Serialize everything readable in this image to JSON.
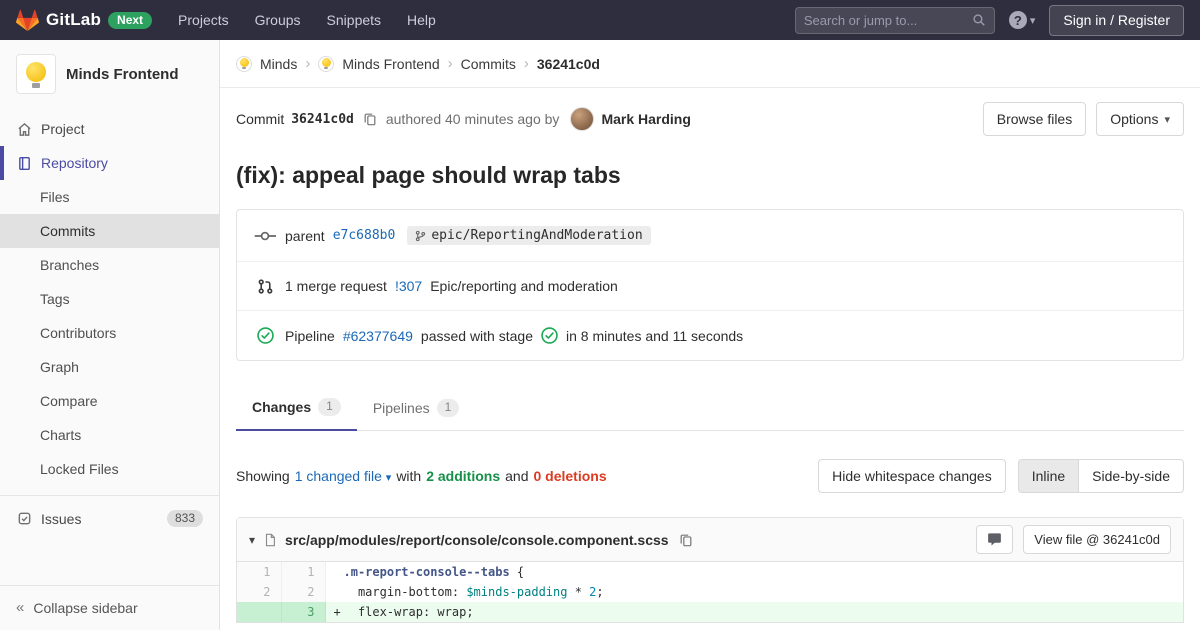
{
  "colors": {
    "navbar_bg": "#2e2e3f",
    "accent": "#4b4ba3",
    "link": "#1b69b6",
    "success": "#1aaa55",
    "additions_green": "#168f48",
    "deletions_red": "#db3b21",
    "next_badge_green": "#2da160",
    "added_line_bg": "#ecfdf0"
  },
  "icons": {
    "caret_down": "▾",
    "separator": "›",
    "collapse": "«",
    "help": "?",
    "project_avatar": "lightbulb"
  },
  "navbar": {
    "brand": "GitLab",
    "next_badge": "Next",
    "menu": {
      "projects": "Projects",
      "groups": "Groups",
      "snippets": "Snippets",
      "help": "Help"
    },
    "search_placeholder": "Search or jump to...",
    "sign_in_label": "Sign in / Register"
  },
  "sidebar": {
    "project_name": "Minds Frontend",
    "items": {
      "project": "Project",
      "repository": "Repository",
      "files": "Files",
      "commits": "Commits",
      "branches": "Branches",
      "tags": "Tags",
      "contributors": "Contributors",
      "graph": "Graph",
      "compare": "Compare",
      "charts": "Charts",
      "locked_files": "Locked Files",
      "issues": "Issues"
    },
    "issues_count": "833",
    "collapse_label": "Collapse sidebar"
  },
  "breadcrumb": {
    "group": "Minds",
    "project": "Minds Frontend",
    "section": "Commits",
    "current": "36241c0d"
  },
  "commit": {
    "label": "Commit",
    "sha": "36241c0d",
    "authored_text": "authored 40 minutes ago by",
    "author": "Mark Harding",
    "browse_files_label": "Browse files",
    "options_label": "Options",
    "title": "(fix): appeal page should wrap tabs",
    "parent_label": "parent",
    "parent_sha": "e7c688b0",
    "branch_ref": "epic/ReportingAndModeration",
    "mr_count_text": "1 merge request",
    "mr_ref": "!307",
    "mr_title": "Epic/reporting and moderation",
    "pipeline_label": "Pipeline",
    "pipeline_id": "#62377649",
    "pipeline_status_text": "passed with stage",
    "pipeline_duration": "in 8 minutes and 11 seconds"
  },
  "tabs": {
    "changes_label": "Changes",
    "changes_count": "1",
    "pipelines_label": "Pipelines",
    "pipelines_count": "1"
  },
  "diff_toolbar": {
    "showing": "Showing",
    "changed_files_link": "1 changed file",
    "with_text": "with",
    "additions": "2 additions",
    "and_text": "and",
    "deletions": "0 deletions",
    "hide_whitespace_label": "Hide whitespace changes",
    "inline_label": "Inline",
    "side_by_side_label": "Side-by-side"
  },
  "file_diff": {
    "path": "src/app/modules/report/console/console.component.scss",
    "view_file_label": "View file @ 36241c0d",
    "lines": [
      {
        "old": "1",
        "new": "1",
        "sign": "",
        "tokens": [
          {
            "text": ".m-report-console--tabs",
            "type": "selector"
          },
          {
            "text": " {",
            "type": "plain"
          }
        ]
      },
      {
        "old": "2",
        "new": "2",
        "sign": "",
        "tokens": [
          {
            "text": "  margin-bottom: ",
            "type": "plain"
          },
          {
            "text": "$minds-padding",
            "type": "variable"
          },
          {
            "text": " * ",
            "type": "plain"
          },
          {
            "text": "2",
            "type": "number"
          },
          {
            "text": ";",
            "type": "plain"
          }
        ]
      },
      {
        "old": "",
        "new": "3",
        "sign": "+",
        "tokens": [
          {
            "text": "  flex-wrap: wrap;",
            "type": "plain"
          }
        ]
      }
    ]
  }
}
